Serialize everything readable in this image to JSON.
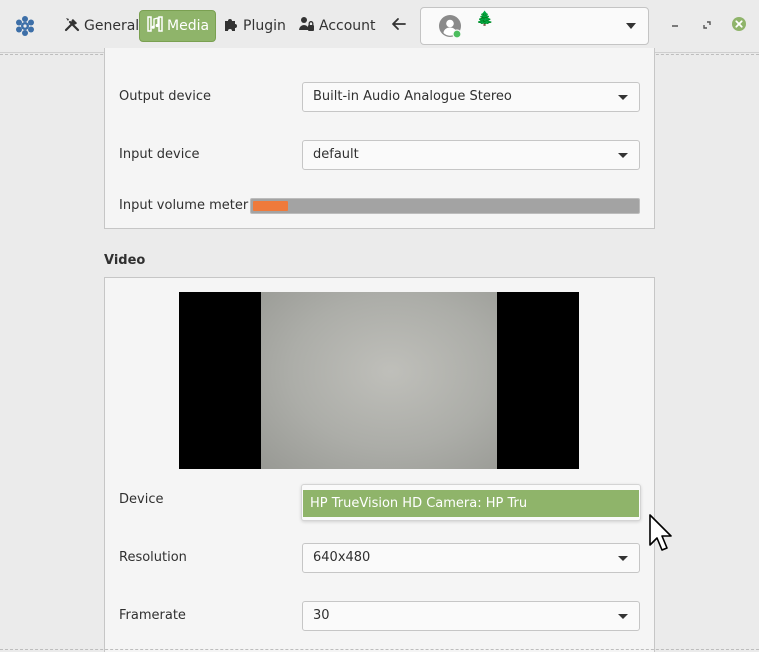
{
  "header": {
    "app_icon": "gear-cluster-icon",
    "tabs": [
      {
        "label": "General",
        "icon": "tools-icon",
        "active": false
      },
      {
        "label": "Media",
        "icon": "media-icon",
        "active": true
      },
      {
        "label": "Plugin",
        "icon": "puzzle-icon",
        "active": false
      },
      {
        "label": "Account",
        "icon": "account-lock-icon",
        "active": false
      }
    ],
    "back_icon": "arrow-left-icon",
    "account_selector": {
      "avatar_icon": "user-avatar-icon",
      "status_color": "#4cbd5e",
      "name": "🌲"
    },
    "window_controls": [
      "minimize-icon",
      "restore-icon",
      "close-icon"
    ]
  },
  "audio": {
    "output_device_label": "Output device",
    "output_device_value": "Built-in Audio Analogue Stereo",
    "input_device_label": "Input device",
    "input_device_value": "default",
    "input_meter_label": "Input volume meter",
    "input_meter_level": 0.09
  },
  "video": {
    "section_title": "Video",
    "device_label": "Device",
    "device_popup_item": "HP TrueVision HD Camera: HP Tru",
    "resolution_label": "Resolution",
    "resolution_value": "640x480",
    "framerate_label": "Framerate",
    "framerate_value": "30"
  },
  "colors": {
    "accent": "#8fb46a",
    "meter_fill": "#ef7a3b",
    "background": "#ebebeb",
    "close_button": "#8fb46a"
  }
}
